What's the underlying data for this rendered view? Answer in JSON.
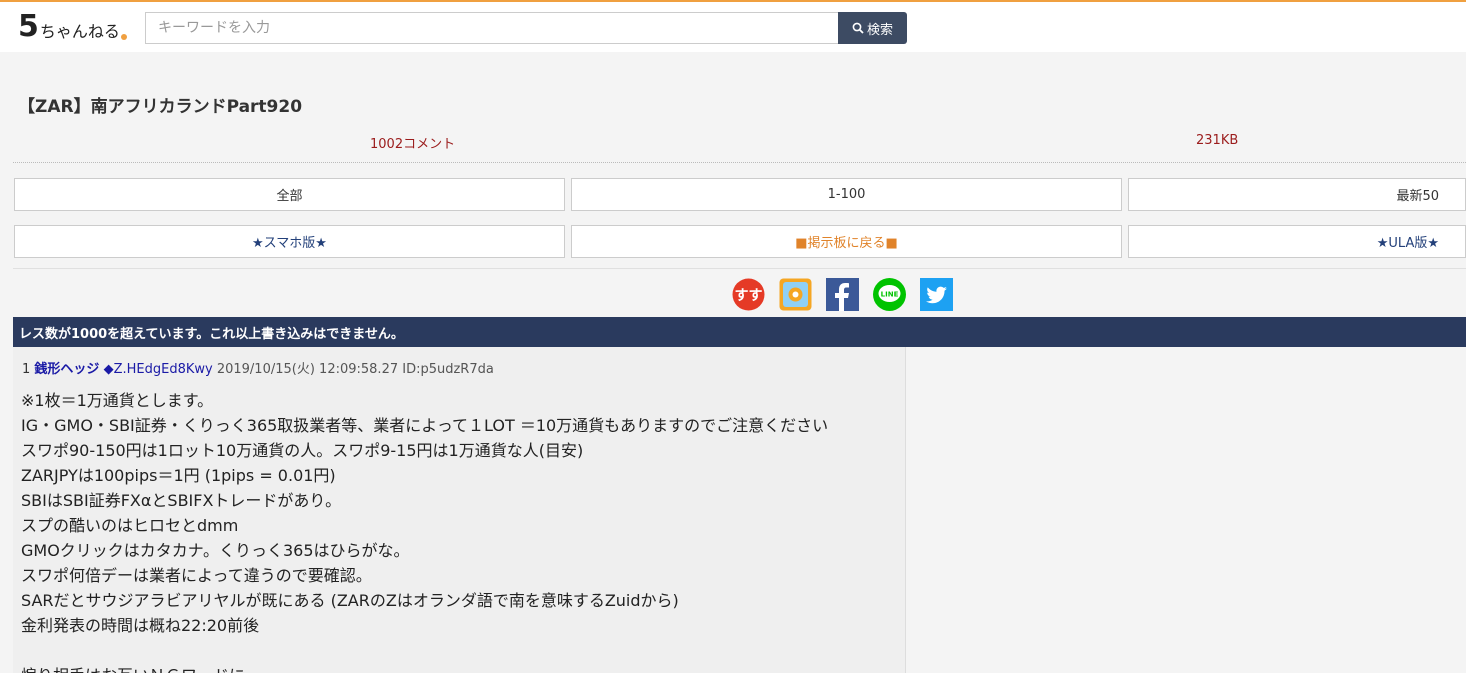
{
  "header": {
    "logo_text": "5ちゃんねる",
    "search_placeholder": "キーワードを入力",
    "search_button": "検索"
  },
  "thread": {
    "title": "【ZAR】南アフリカランドPart920",
    "comments": "1002コメント",
    "size": "231KB"
  },
  "nav": {
    "row1": [
      "全部",
      "1-100",
      "最新50"
    ],
    "row2": [
      "★スマホ版★",
      "■掲示板に戻る■",
      "★ULA版★"
    ]
  },
  "share_icons": [
    "sunsuku-icon",
    "bookmark-icon",
    "facebook-icon",
    "line-icon",
    "twitter-icon"
  ],
  "share_labels": {
    "sunsuku": "すす",
    "line": "LINE"
  },
  "banner": "レス数が1000を超えています。これ以上書き込みはできません。",
  "post": {
    "number": "1",
    "name": "銭形ヘッジ",
    "trip": "◆Z.HEdgEd8Kwy",
    "date": "2019/10/15(火) 12:09:58.27 ID:p5udzR7da",
    "lines": [
      "※1枚＝1万通貨とします。",
      "IG・GMO・SBI証券・くりっく365取扱業者等、業者によって１LOT ＝10万通貨もありますのでご注意ください",
      "スワポ90-150円は1ロット10万通貨の人。スワポ9-15円は1万通貨な人(目安)",
      "ZARJPYは100pips＝1円 (1pips = 0.01円)",
      "SBIはSBI証券FXαとSBIFXトレードがあり。",
      "スプの酷いのはヒロセとdmm",
      "GMOクリックはカタカナ。くりっく365はひらがな。",
      "スワポ何倍デーは業者によって違うので要確認。",
      "SARだとサウジアラビアリヤルが既にある (ZARのZはオランダ語で南を意味するZuidから)",
      "金利発表の時間は概ね22:20前後",
      "",
      "煽り相手はお互いＮＧワードに"
    ]
  },
  "colors": {
    "accent": "#f0a040",
    "banner_bg": "#2a3a5e",
    "search_btn": "#3d4b63",
    "meta_text": "#9b1c1c",
    "name_text": "#1a1aa6"
  }
}
